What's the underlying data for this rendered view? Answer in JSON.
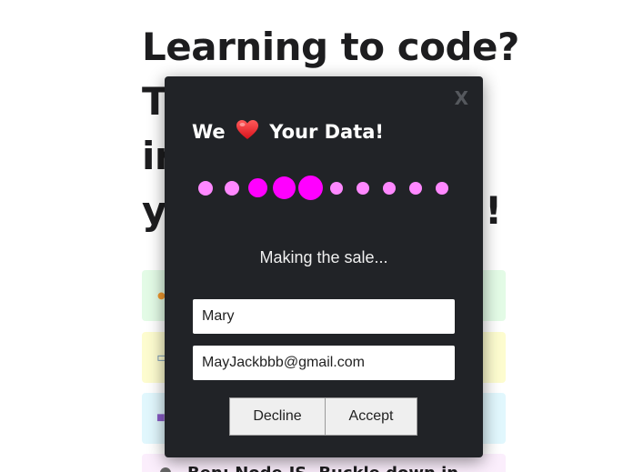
{
  "background": {
    "headline_lines": [
      "Learning to code?",
      "T",
      "ir",
      "y",
      "!"
    ],
    "cards": [
      {
        "color": "#e3fbe6",
        "icon": "orange-emoji"
      },
      {
        "color": "#fdfccf",
        "icon": "laptop-emoji"
      },
      {
        "color": "#e1f7fd",
        "icon": "purple-emoji"
      },
      {
        "color": "#fbeefc",
        "icon": "none"
      }
    ],
    "last_item_text": "Ben: Node.JS. Buckle down in"
  },
  "modal": {
    "close_label": "X",
    "title_before": "We",
    "title_icon": "heart-icon",
    "title_after": "Your Data!",
    "dots": {
      "count": 10,
      "active_color": "#ff00ff",
      "inactive_color": "#ff88ff"
    },
    "status": "Making the sale...",
    "name_value": "Mary",
    "email_value": "MayJackbbb@gmail.com",
    "decline_label": "Decline",
    "accept_label": "Accept"
  }
}
